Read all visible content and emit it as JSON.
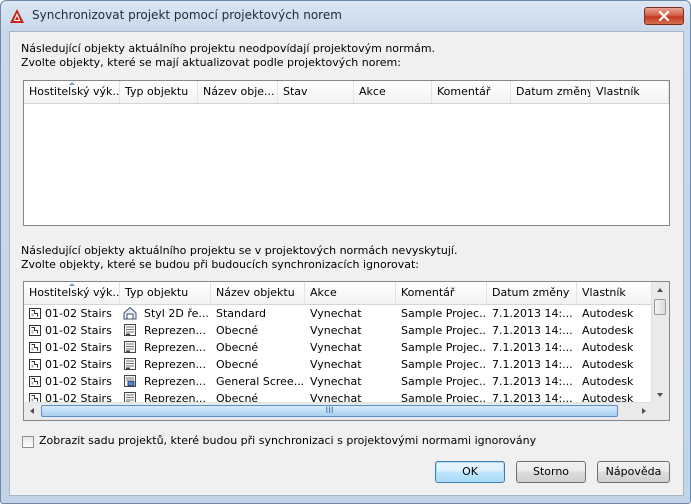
{
  "window": {
    "title": "Synchronizovat projekt pomocí projektových norem",
    "app_icon": "autocad-a-icon",
    "close_icon": "close-icon"
  },
  "section1": {
    "line1": "Následující objekty aktuálního projektu neodpovídají projektovým normám.",
    "line2": "Zvolte objekty, které se mají aktualizovat podle projektových norem:",
    "columns": [
      "Hostitelský výk...",
      "Typ objektu",
      "Název obje...",
      "Stav",
      "Akce",
      "Komentář",
      "Datum změny",
      "Vlastník"
    ],
    "rows": []
  },
  "section2": {
    "line1": "Následující objekty aktuálního projektu se v projektových normách nevyskytují.",
    "line2": "Zvolte objekty, které se budou při budoucích synchronizacích ignorovat:",
    "columns": [
      "Hostitelský výk...",
      "Typ objektu",
      "Název objektu",
      "Akce",
      "Komentář",
      "Datum změny",
      "Vlastník"
    ],
    "rows": [
      {
        "host": "01-02 Stairs",
        "type": "Styl 2D ře...",
        "type_icon": "2d-style-icon",
        "name": "Standard",
        "action": "Vynechat",
        "comment": "Sample Projec...",
        "date": "7.1.2013 14:...",
        "owner": "Autodesk"
      },
      {
        "host": "01-02 Stairs",
        "type": "Reprezen...",
        "type_icon": "representation-icon",
        "name": "Obecné",
        "action": "Vynechat",
        "comment": "Sample Projec...",
        "date": "7.1.2013 14:...",
        "owner": "Autodesk"
      },
      {
        "host": "01-02 Stairs",
        "type": "Reprezen...",
        "type_icon": "representation-icon",
        "name": "Obecné",
        "action": "Vynechat",
        "comment": "Sample Projec...",
        "date": "7.1.2013 14:...",
        "owner": "Autodesk"
      },
      {
        "host": "01-02 Stairs",
        "type": "Reprezen...",
        "type_icon": "representation-icon",
        "name": "Obecné",
        "action": "Vynechat",
        "comment": "Sample Projec...",
        "date": "7.1.2013 14:...",
        "owner": "Autodesk"
      },
      {
        "host": "01-02 Stairs",
        "type": "Reprezen...",
        "type_icon": "representation-screen-icon",
        "name": "General Scree...",
        "action": "Vynechat",
        "comment": "Sample Projec...",
        "date": "7.1.2013 14:...",
        "owner": "Autodesk"
      },
      {
        "host": "01-02 Stairs",
        "type": "Reprezen...",
        "type_icon": "representation-icon",
        "name": "Obecné",
        "action": "Vynechat",
        "comment": "Sample Projec...",
        "date": "7.1.2013 14:...",
        "owner": "Autodesk"
      }
    ],
    "hscroll_grip": "III"
  },
  "checkbox": {
    "label": "Zobrazit sadu projektů, které budou při synchronizaci s projektovými normami ignorovány",
    "checked": false
  },
  "buttons": {
    "ok": "OK",
    "cancel": "Storno",
    "help": "Nápověda"
  },
  "colors": {
    "title_bar": "#c9d8ea",
    "close_button": "#c2391f",
    "default_button_border": "#3c7fb1",
    "scroll_thumb": "#a9d1f2"
  }
}
